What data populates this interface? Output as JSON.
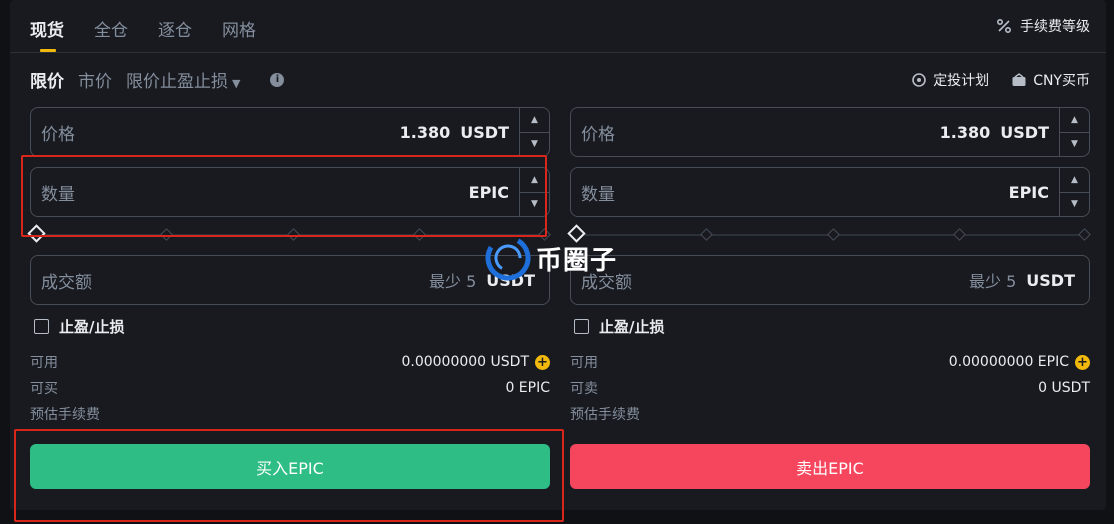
{
  "top_tabs": [
    "现货",
    "全仓",
    "逐仓",
    "网格"
  ],
  "fee_level": "手续费等级",
  "order_tabs": {
    "limit": "限价",
    "market": "市价",
    "stop_limit": "限价止盈止损"
  },
  "links": {
    "dca": "定投计划",
    "cny": "CNY买币"
  },
  "buy": {
    "price_label": "价格",
    "price_value": "1.380",
    "price_unit": "USDT",
    "qty_label": "数量",
    "qty_unit": "EPIC",
    "total_label": "成交额",
    "total_min": "最少 5",
    "total_unit": "USDT",
    "tpsl_label": "止盈/止损",
    "avail_label": "可用",
    "avail_value": "0.00000000 USDT",
    "max_label": "可买",
    "max_value": "0 EPIC",
    "fee_label": "预估手续费",
    "button": "买入EPIC"
  },
  "sell": {
    "price_label": "价格",
    "price_value": "1.380",
    "price_unit": "USDT",
    "qty_label": "数量",
    "qty_unit": "EPIC",
    "total_label": "成交额",
    "total_min": "最少 5",
    "total_unit": "USDT",
    "tpsl_label": "止盈/止损",
    "avail_label": "可用",
    "avail_value": "0.00000000 EPIC",
    "max_label": "可卖",
    "max_value": "0 USDT",
    "fee_label": "预估手续费",
    "button": "卖出EPIC"
  },
  "watermark": "币圈子",
  "colors": {
    "buy": "#2ebd85",
    "sell": "#f6465d",
    "accent": "#f0b90b",
    "highlight": "#d9261c"
  }
}
